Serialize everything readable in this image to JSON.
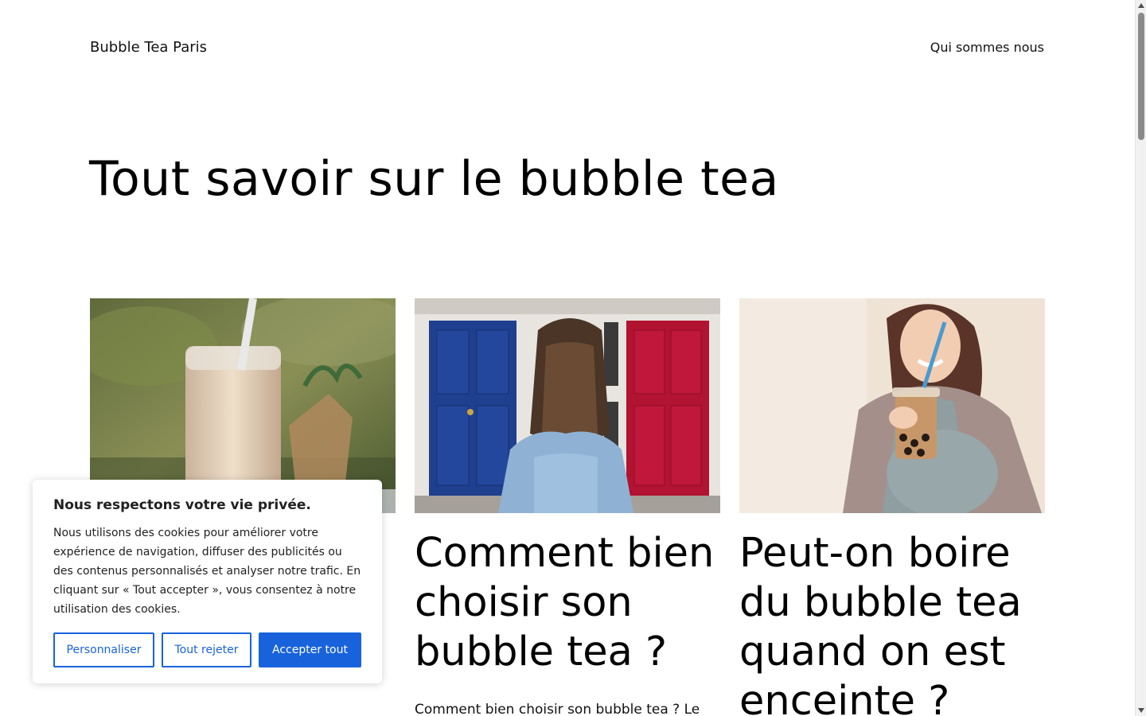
{
  "header": {
    "site_title": "Bubble Tea Paris",
    "nav_link": "Qui sommes nous"
  },
  "hero": {
    "title": "Tout savoir sur le bubble tea"
  },
  "cards": [
    {
      "title_visible_tail": "?",
      "image": "milk-bubble-tea-glass-photo"
    },
    {
      "title": "Comment bien choisir son bubble tea ?",
      "excerpt": "Comment bien choisir son bubble tea ? Le",
      "image": "woman-between-blue-and-red-doors-photo"
    },
    {
      "title": "Peut-on boire du bubble tea quand on est enceinte ?",
      "image": "pregnant-woman-drinking-bubble-tea-photo"
    }
  ],
  "cookie_banner": {
    "title": "Nous respectons votre vie privée.",
    "text": "Nous utilisons des cookies pour améliorer votre expérience de navigation, diffuser des publicités ou des contenus personnalisés et analyser notre trafic. En cliquant sur « Tout accepter », vous consentez à notre utilisation des cookies.",
    "customize_label": "Personnaliser",
    "reject_label": "Tout rejeter",
    "accept_label": "Accepter tout"
  },
  "colors": {
    "accent": "#1863dc",
    "text": "#212121"
  }
}
